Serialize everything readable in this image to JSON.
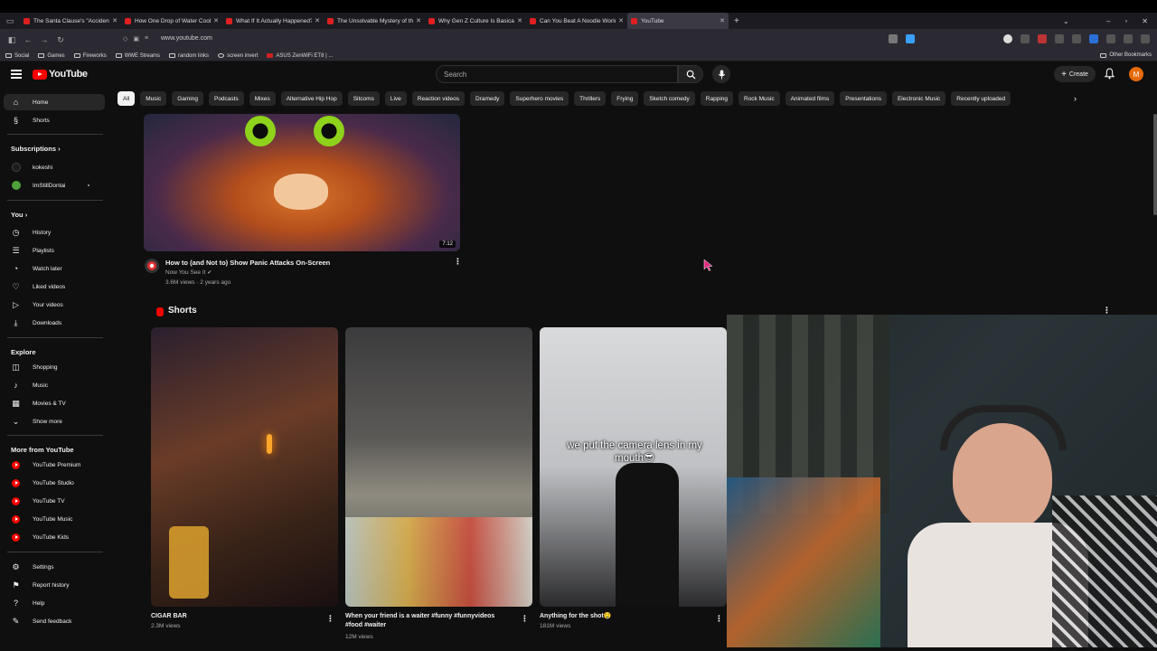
{
  "browser": {
    "tabs": [
      {
        "label": "The Santa Clause's \"Accident\" is"
      },
      {
        "label": "How One Drop of Water Cools"
      },
      {
        "label": "What If It Actually Happened?"
      },
      {
        "label": "The Unsolvable Mystery of the"
      },
      {
        "label": "Why Gen Z Culture Is Basically"
      },
      {
        "label": "Can You Beat A Noodle World"
      },
      {
        "label": "YouTube"
      }
    ],
    "url": "www.youtube.com",
    "bookmarks": [
      "Social",
      "Games",
      "Fireworks",
      "WWE Streams",
      "random links",
      "screen invert",
      "ASUS ZenWiFi ET8 | ..."
    ],
    "other_bookmarks": "Other Bookmarks"
  },
  "header": {
    "logo": "YouTube",
    "search_placeholder": "Search",
    "create_label": "Create",
    "avatar_letter": "M"
  },
  "chips": [
    "All",
    "Music",
    "Gaming",
    "Podcasts",
    "Mixes",
    "Alternative Hip Hop",
    "Sitcoms",
    "Live",
    "Reaction videos",
    "Dramedy",
    "Superhero movies",
    "Thrillers",
    "Frying",
    "Sketch comedy",
    "Rapping",
    "Rock Music",
    "Animated films",
    "Presentations",
    "Electronic Music",
    "Recently uploaded"
  ],
  "sidebar": {
    "home": "Home",
    "shorts": "Shorts",
    "subscriptions_heading": "Subscriptions",
    "subscriptions": [
      "kokeshi",
      "ImStillDontai"
    ],
    "you_heading": "You",
    "you_items": [
      "History",
      "Playlists",
      "Watch later",
      "Liked videos",
      "Your videos",
      "Downloads"
    ],
    "explore_heading": "Explore",
    "explore_items": [
      "Shopping",
      "Music",
      "Movies & TV",
      "Show more"
    ],
    "more_heading": "More from YouTube",
    "more_items": [
      "YouTube Premium",
      "YouTube Studio",
      "YouTube TV",
      "YouTube Music",
      "YouTube Kids"
    ],
    "footer_items": [
      "Settings",
      "Report history",
      "Help",
      "Send feedback"
    ]
  },
  "video": {
    "title": "How to (and Not to) Show Panic Attacks On-Screen",
    "channel": "Now You See It",
    "meta": "3.6M views · 2 years ago",
    "duration": "7:12"
  },
  "shorts": {
    "heading": "Shorts",
    "items": [
      {
        "title": "CIGAR BAR",
        "title2": "",
        "views": "2.3M views",
        "overlay": ""
      },
      {
        "title": "When your friend is a waiter #funny #funnyvideos",
        "title2": "#food #waiter",
        "views": "12M views",
        "overlay": ""
      },
      {
        "title": "Anything for the shot🤤",
        "title2": "",
        "views": "181M views",
        "overlay": "we put the camera lens in my mouth😎"
      }
    ]
  }
}
